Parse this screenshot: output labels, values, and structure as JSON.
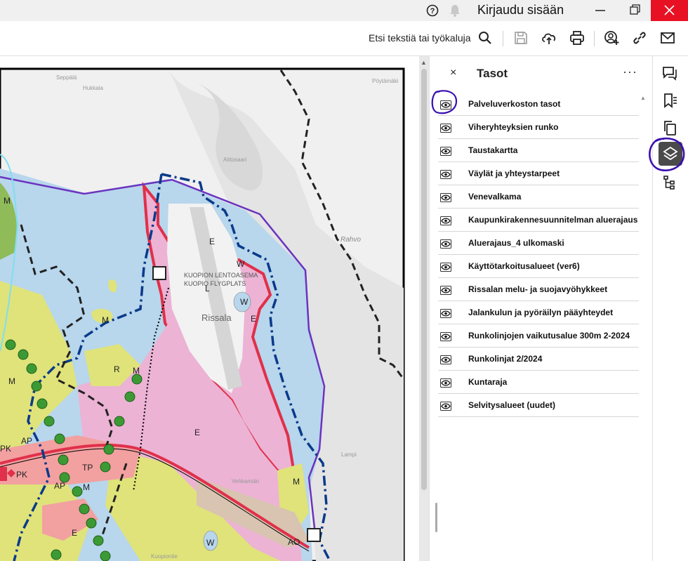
{
  "titlebar": {
    "sign_in": "Kirjaudu sisään",
    "icons": [
      "help-icon",
      "bell-icon",
      "minimize-icon",
      "restore-icon",
      "close-icon"
    ]
  },
  "toolbar": {
    "search_label": "Etsi tekstiä tai työkaluja",
    "icons": [
      "search-icon",
      "save-icon",
      "upload-icon",
      "print-icon",
      "add-user-icon",
      "link-icon",
      "mail-icon"
    ]
  },
  "panel": {
    "title": "Tasot",
    "close_label": "×",
    "more_label": "···",
    "layers": [
      {
        "label": "Palveluverkoston tasot"
      },
      {
        "label": "Viheryhteyksien runko"
      },
      {
        "label": "Taustakartta"
      },
      {
        "label": "Väylät ja yhteystarpeet"
      },
      {
        "label": "Venevalkama"
      },
      {
        "label": "Kaupunkirakennesuunnitelman aluerajaus"
      },
      {
        "label": "Aluerajaus_4 ulkomaski"
      },
      {
        "label": "Käyttötarkoitusalueet (ver6)"
      },
      {
        "label": "Rissalan melu- ja suojavyöhykkeet"
      },
      {
        "label": "Jalankulun ja pyöräilyn pääyhteydet"
      },
      {
        "label": "Runkolinjojen vaikutusalue 300m 2-2024"
      },
      {
        "label": "Runkolinjat 2/2024"
      },
      {
        "label": "Kuntaraja"
      },
      {
        "label": "Selvitysalueet (uudet)"
      }
    ]
  },
  "rail": {
    "icons": [
      "comment-icon",
      "bookmark-icon",
      "pages-icon",
      "layers-icon",
      "tree-icon"
    ]
  },
  "map": {
    "labels": {
      "airport_fi": "KUOPION LENTOASEMA",
      "airport_sv": "KUOPIO FLYGPLATS",
      "rissala": "Rissala",
      "rahvo": "Rahvo",
      "seppala": "Seppälä",
      "hukkala": "Hukkala",
      "poytalamaki": "Pöytämäki",
      "aittosaari": "Aittosaari",
      "vehkamaki": "Vehkamäki",
      "lampi": "Lampi",
      "kuopiontie": "Kuopiontie",
      "zone_E1": "E",
      "zone_E2": "E",
      "zone_E3": "E",
      "zone_E4": "E",
      "zone_W1": "W",
      "zone_W2": "W",
      "zone_W3": "W",
      "zone_L": "L",
      "zone_M1": "M",
      "zone_M2": "M",
      "zone_M3": "M",
      "zone_M4": "M",
      "zone_M5": "M",
      "zone_M6": "M",
      "zone_R": "R",
      "zone_AP1": "AP",
      "zone_AP2": "AP",
      "zone_PK1": "PK",
      "zone_PK2": "PK",
      "zone_TP": "TP",
      "zone_AO": "AO"
    }
  },
  "colors": {
    "water": "#b8d6ec",
    "residential_pink": "#ecb3d4",
    "field_yellow": "#dfe37a",
    "forest_green": "#8fbb58",
    "boundary_purple": "#6a33c0",
    "boundary_blue": "#0a3a8a",
    "route_red": "#e0304a",
    "green_dot": "#3c9a34",
    "annotation": "#3a0fb0",
    "close_red": "#e81123"
  }
}
